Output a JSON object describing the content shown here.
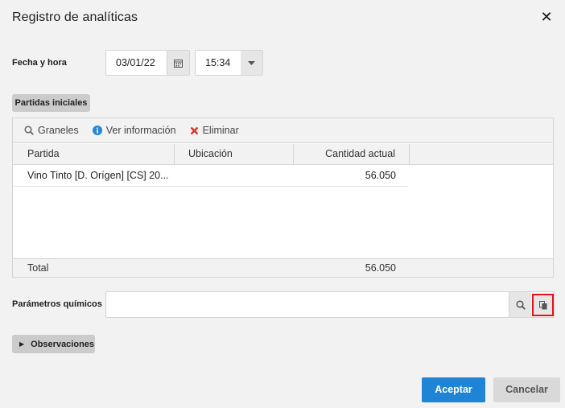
{
  "dialog": {
    "title": "Registro de analíticas",
    "close_icon": "close-icon"
  },
  "datetime": {
    "label": "Fecha y hora",
    "date_value": "03/01/22",
    "time_value": "15:34",
    "calendar_icon": "calendar-icon",
    "dropdown_icon": "chevron-down-icon"
  },
  "partidas": {
    "chip_label": "Partidas iniciales",
    "toolbar": {
      "graneles_label": "Graneles",
      "ver_info_label": "Ver información",
      "eliminar_label": "Eliminar"
    },
    "columns": [
      "Partida",
      "Ubicación",
      "Cantidad actual"
    ],
    "rows": [
      {
        "partida": "Vino Tinto [D. Orígen] [CS] 20...",
        "ubicacion": "",
        "cantidad": "56.050"
      }
    ],
    "footer": {
      "label": "Total",
      "value": "56.050"
    }
  },
  "parametros": {
    "label": "Parámetros químicos",
    "value": "",
    "search_icon": "search-icon",
    "copy_icon": "copy-icon"
  },
  "observaciones": {
    "label": "Observaciones",
    "expand_icon": "triangle-right-icon"
  },
  "actions": {
    "ok_label": "Aceptar",
    "cancel_label": "Cancelar"
  },
  "colors": {
    "accent": "#1f84d6",
    "highlight": "#e8111b",
    "info_icon": "#2a86d8",
    "delete_icon": "#d9342b"
  }
}
